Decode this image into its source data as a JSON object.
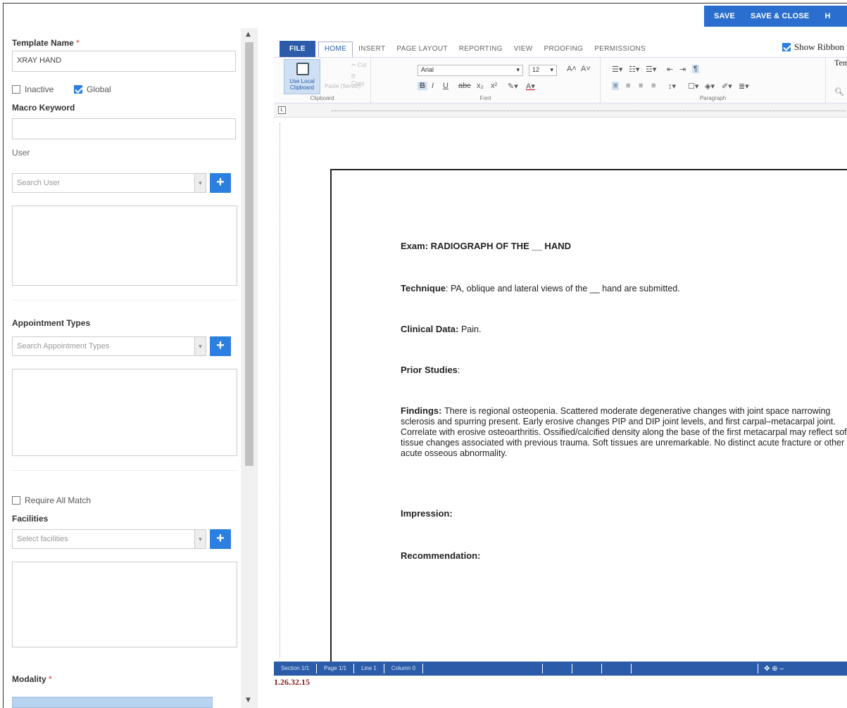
{
  "actions": {
    "save": "SAVE",
    "save_close": "SAVE & CLOSE",
    "help": "H"
  },
  "form": {
    "template_name_label": "Template Name",
    "required_mark": "*",
    "template_name_value": "XRAY HAND",
    "inactive_label": "Inactive",
    "inactive_checked": false,
    "global_label": "Global",
    "global_checked": true,
    "macro_keyword_label": "Macro Keyword",
    "macro_keyword_value": "",
    "user_label": "User",
    "user_placeholder": "Search User",
    "appointment_types_label": "Appointment Types",
    "appointment_types_placeholder": "Search Appointment Types",
    "require_all_match_label": "Require All Match",
    "require_all_match_checked": false,
    "facilities_label": "Facilities",
    "facilities_placeholder": "Select facilities",
    "modality_label": "Modality"
  },
  "editor": {
    "tabs": [
      "FILE",
      "HOME",
      "INSERT",
      "PAGE LAYOUT",
      "REPORTING",
      "VIEW",
      "PROOFING",
      "PERMISSIONS"
    ],
    "active_tab": "HOME",
    "show_ribbon_label": "Show Ribbon",
    "show_ribbon_checked": true,
    "ribbon": {
      "use_local_clipboard": "Use Local Clipboard",
      "paste": "Paste (Server)",
      "cut": "Cut",
      "copy": "Copy",
      "clipboard_group": "Clipboard",
      "font_name": "Arial",
      "font_size": "12",
      "font_group": "Font",
      "paragraph_group": "Paragraph",
      "template_name_overlay": "Template Name"
    },
    "document": {
      "exam_label": "Exam: RADIOGRAPH OF THE __ HAND",
      "technique_label": "Technique",
      "technique_text": ": PA, oblique and lateral views of the __ hand are submitted.",
      "clinical_label": "Clinical Data: ",
      "clinical_text": "Pain.",
      "prior_label": "Prior Studies",
      "prior_text": ":",
      "findings_label": "Findings: ",
      "findings_text": "There is regional osteopenia.  Scattered moderate degenerative changes with joint space narrowing sclerosis and spurring present.  Early erosive changes PIP and DIP joint levels, and first carpal–metacarpal joint.  Correlate with erosive osteoarthritis.  Ossified/calcified density along the base of the first metacarpal may reflect soft tissue changes associated with previous trauma.  Soft tissues are unremarkable.  No distinct acute fracture or other acute osseous abnormality.",
      "impression_label": "Impression:",
      "recommendation_label": "Recommendation:"
    },
    "status": {
      "section": "Section 1/1",
      "page": "Page 1/1",
      "line": "Line 1",
      "column": "Column 0"
    },
    "version": "1.26.32.15"
  },
  "colors": {
    "accent": "#2a7fe0",
    "action_bar": "#2a6fcf",
    "status_bar": "#2a5caa",
    "version_text": "#8b1a1a"
  }
}
